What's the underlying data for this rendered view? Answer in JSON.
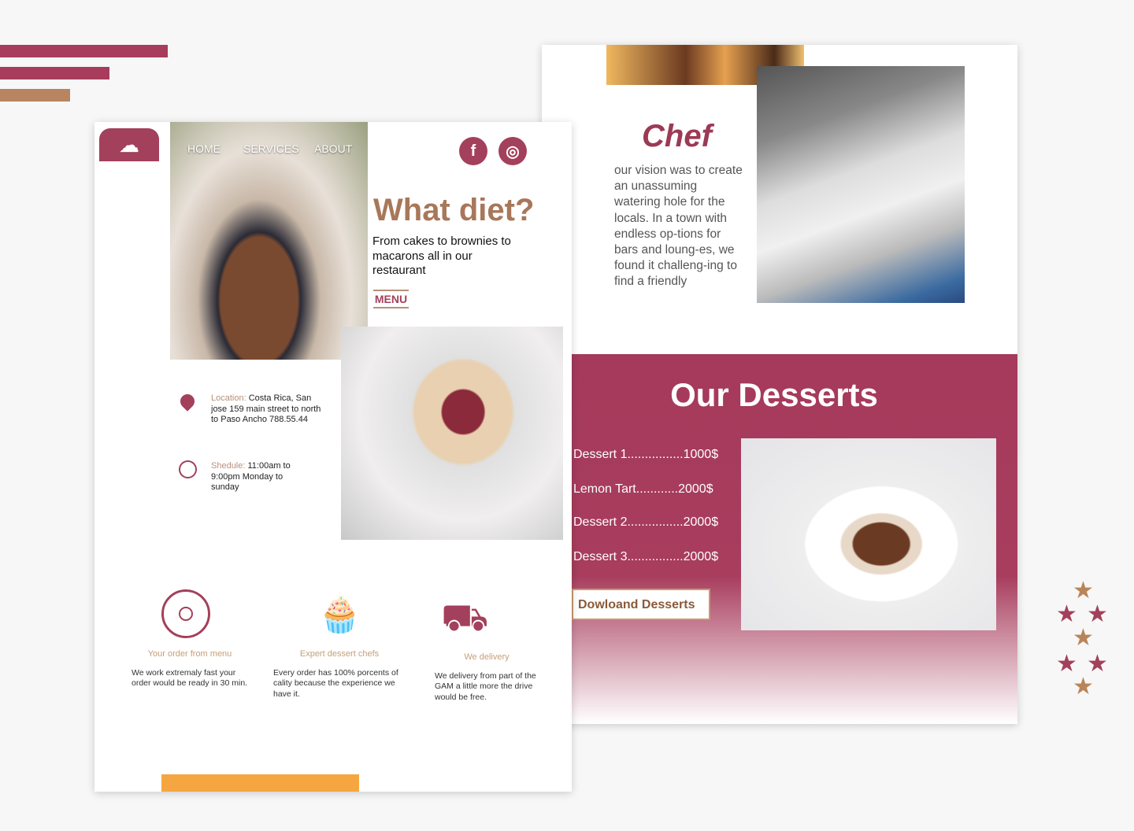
{
  "colors": {
    "maroon": "#a83c5c",
    "brown": "#a8775a",
    "orange": "#f5a640"
  },
  "left_page": {
    "logo": "chef-hat-icon",
    "nav": [
      "HOME",
      "SERVICES",
      "ABOUT"
    ],
    "social": [
      {
        "icon": "facebook-icon",
        "glyph": "f"
      },
      {
        "icon": "instagram-icon",
        "glyph": "◎"
      }
    ],
    "hero_title": "What diet?",
    "hero_text": "From cakes to brownies to macarons all in our restaurant",
    "menu_label": "MENU",
    "location": {
      "label": "Location:",
      "text": " Costa Rica, San jose 159 main street to north to Paso Ancho 788.55.44"
    },
    "schedule": {
      "label": "Shedule:",
      "text": " 11:00am to 9:00pm Monday to sunday"
    },
    "features": [
      {
        "title": "Your order from menu",
        "text": "We work extremaly fast your order would be ready in 30 min."
      },
      {
        "title": "Expert dessert chefs",
        "text": "Every order has 100% porcents of cality because the experience we have it."
      },
      {
        "title": "We delivery",
        "text": "We delivery from part of the GAM a little more the drive would be free."
      }
    ]
  },
  "right_page": {
    "chef_title": "Chef",
    "chef_text": "our vision was to create an unassuming watering hole for the locals. In a town with endless op-tions for bars and loung-es, we found it challeng-ing to find a friendly",
    "desserts_title": "Our Desserts",
    "desserts": [
      "Dessert 1................1000$",
      "Lemon Tart............2000$",
      "Dessert 2................2000$",
      "Dessert 3................2000$"
    ],
    "download_label": "Dowloand Desserts"
  }
}
